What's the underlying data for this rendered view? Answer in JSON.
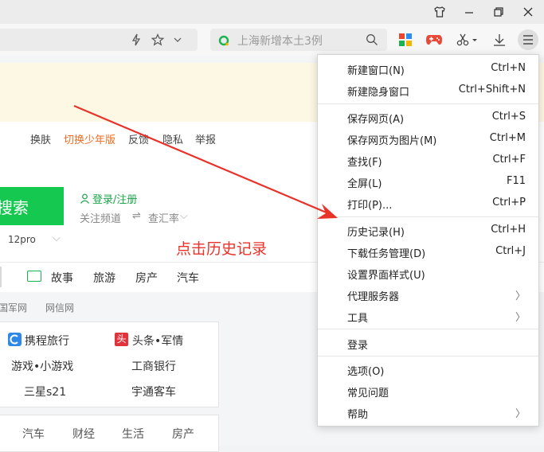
{
  "search": {
    "placeholder": "上海新增本土3例"
  },
  "header_links": [
    "换肤",
    "切换少年版",
    "反馈",
    "隐私",
    "举报"
  ],
  "search_button": "搜索",
  "login": "登录/注册",
  "follow": "关注频道",
  "rate": "查汇率",
  "phone_hint": "12pro",
  "nav_tabs": [
    "故事",
    "旅游",
    "房产",
    "汽车"
  ],
  "small_links": [
    "国军网",
    "网信网"
  ],
  "sites": {
    "row1_left": "携程旅行",
    "row1_right": "头条•军情",
    "row2_left": "游戏•小游戏",
    "row2_right": "工商银行",
    "row3_left": "三星s21",
    "row3_right": "宇通客车"
  },
  "bottom_nav": [
    "汽车",
    "财经",
    "生活",
    "房产"
  ],
  "annotation": "点击历史记录",
  "menu": {
    "new_window": "新建窗口(N)",
    "new_window_sc": "Ctrl+N",
    "new_incognito": "新建隐身窗口",
    "new_incognito_sc": "Ctrl+Shift+N",
    "save_page": "保存网页(A)",
    "save_page_sc": "Ctrl+S",
    "save_image": "保存网页为图片(M)",
    "save_image_sc": "Ctrl+M",
    "find": "查找(F)",
    "find_sc": "Ctrl+F",
    "fullscreen": "全屏(L)",
    "fullscreen_sc": "F11",
    "print": "打印(P)...",
    "print_sc": "Ctrl+P",
    "history": "历史记录(H)",
    "history_sc": "Ctrl+H",
    "downloads": "下载任务管理(D)",
    "downloads_sc": "Ctrl+J",
    "ui_style": "设置界面样式(U)",
    "proxy": "代理服务器",
    "tools": "工具",
    "login": "登录",
    "options": "选项(O)",
    "faq": "常见问题",
    "help": "帮助"
  },
  "colors": {
    "accent_green": "#15c84f",
    "annotation_red": "#e8332b",
    "arrow_red": "#e8332b"
  }
}
